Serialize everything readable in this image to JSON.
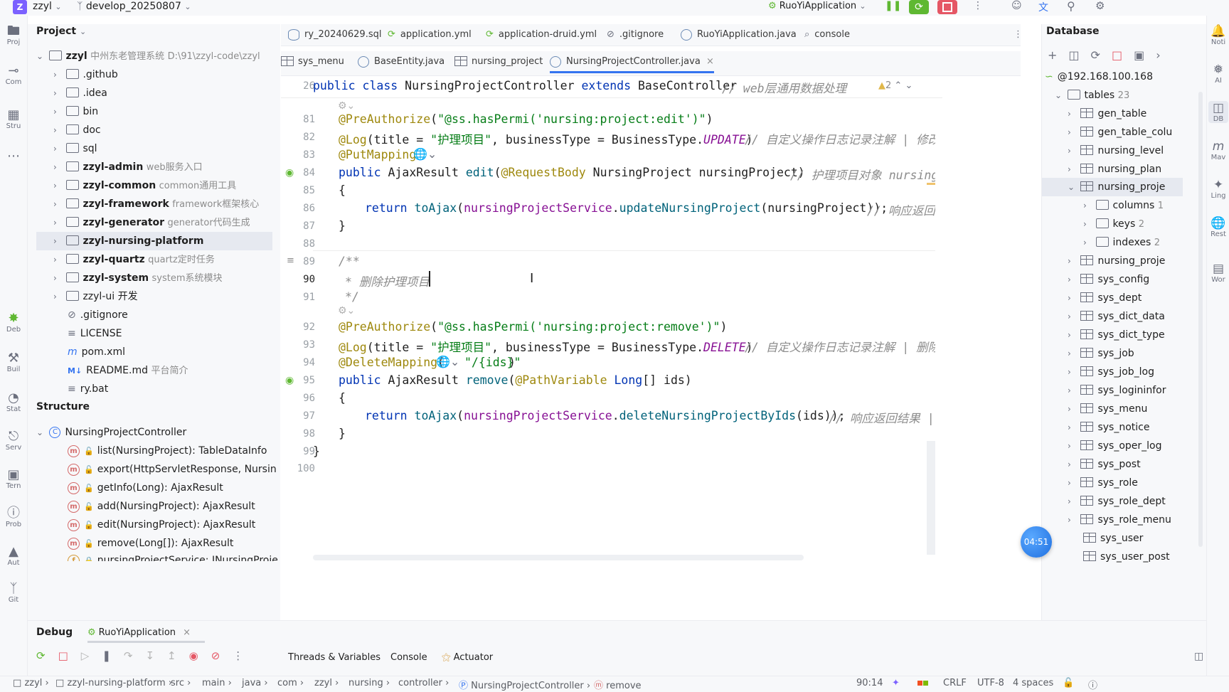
{
  "topbar": {
    "project_badge": "Z",
    "project_name": "zzyl",
    "branch": "develop_20250807",
    "run_config": "RuoYiApplication"
  },
  "left_strip": [
    {
      "icon": "folder-icon",
      "label": "Proj"
    },
    {
      "icon": "commit-icon",
      "label": "Com"
    },
    {
      "icon": "structure-icon",
      "label": "Stru"
    },
    {
      "icon": "more-icon",
      "label": "..."
    },
    {
      "icon": "debug-icon",
      "label": "Deb"
    },
    {
      "icon": "build-icon",
      "label": "Buil"
    },
    {
      "icon": "status-icon",
      "label": "Stat"
    },
    {
      "icon": "services-icon",
      "label": "Serv"
    },
    {
      "icon": "terminal-icon",
      "label": "Tern"
    },
    {
      "icon": "problems-icon",
      "label": "Prob"
    },
    {
      "icon": "warning-icon",
      "label": "Aut"
    },
    {
      "icon": "git-icon",
      "label": "Git"
    }
  ],
  "right_strip": [
    {
      "icon": "notifications-icon",
      "label": "Noti"
    },
    {
      "icon": "ai-icon",
      "label": "AI"
    },
    {
      "icon": "database-icon",
      "label": "DB"
    },
    {
      "icon": "maven-icon",
      "label": "Mav"
    },
    {
      "icon": "lingma-icon",
      "label": "Ling"
    },
    {
      "icon": "rest-icon",
      "label": "Rest"
    },
    {
      "icon": "word-icon",
      "label": "Wor"
    }
  ],
  "project": {
    "title": "Project",
    "root_name": "zzyl",
    "root_desc": "中州东老管理系统",
    "root_path": "D:\\91\\zzyl-code\\zzyl",
    "items": [
      {
        "name": ".github",
        "desc": ""
      },
      {
        "name": ".idea",
        "desc": ""
      },
      {
        "name": "bin",
        "desc": ""
      },
      {
        "name": "doc",
        "desc": ""
      },
      {
        "name": "sql",
        "desc": ""
      },
      {
        "name": "zzyl-admin",
        "desc": "web服务入口"
      },
      {
        "name": "zzyl-common",
        "desc": "common通用工具"
      },
      {
        "name": "zzyl-framework",
        "desc": "framework框架核心"
      },
      {
        "name": "zzyl-generator",
        "desc": "generator代码生成"
      },
      {
        "name": "zzyl-nursing-platform",
        "desc": ""
      },
      {
        "name": "zzyl-quartz",
        "desc": "quartz定时任务"
      },
      {
        "name": "zzyl-system",
        "desc": "system系统模块"
      },
      {
        "name": "zzyl-ui",
        "desc": "开发"
      }
    ],
    "files": [
      {
        "name": ".gitignore",
        "desc": ""
      },
      {
        "name": "LICENSE",
        "desc": ""
      },
      {
        "name": "pom.xml",
        "desc": ""
      },
      {
        "name": "README.md",
        "desc": "平台简介"
      },
      {
        "name": "ry.bat",
        "desc": ""
      }
    ]
  },
  "structure": {
    "title": "Structure",
    "class_name": "NursingProjectController",
    "members": [
      "list(NursingProject): TableDataInfo",
      "export(HttpServletResponse, Nursin",
      "getInfo(Long): AjaxResult",
      "add(NursingProject): AjaxResult",
      "edit(NursingProject): AjaxResult",
      "remove(Long[]): AjaxResult",
      "nursingProjectService: INursingProje"
    ]
  },
  "tabs_row1": [
    "ry_20240629.sql",
    "application.yml",
    "application-druid.yml",
    ".gitignore",
    "RuoYiApplication.java",
    "console"
  ],
  "tabs_row2": [
    "sys_menu",
    "BaseEntity.java",
    "nursing_project",
    "NursingProjectController.java"
  ],
  "editor": {
    "sticky_line": "26",
    "sticky_code": "public class NursingProjectController extends BaseController",
    "sticky_comment": "// web层通用数据处理",
    "warning_count": "2",
    "line_numbers": [
      "81",
      "82",
      "83",
      "84",
      "85",
      "86",
      "87",
      "88",
      "89",
      "90",
      "91",
      "92",
      "93",
      "94",
      "95",
      "96",
      "97",
      "98",
      "99",
      "100"
    ],
    "comments": {
      "log_edit": "// 自定义操作日志记录注解 | 修改",
      "edit_sig": "// 护理项目对象 nursing_",
      "return_edit": "// 响应返回",
      "doc_body": "* 删除护理项目",
      "log_remove": "// 自定义操作日志记录注解 | 删除",
      "return_remove": "// 响应返回结果 |"
    },
    "strings": {
      "perm_edit": "\"@ss.hasPermi('nursing:project:edit')\"",
      "title_edit": "\"护理项目\"",
      "perm_remove": "\"@ss.hasPermi('nursing:project:remove')\"",
      "title_remove": "\"护理项目\"",
      "ids_path": "\"/{ids}\""
    }
  },
  "database": {
    "title": "Database",
    "host": "@192.168.100.168",
    "tables_label": "tables",
    "tables_count": "23",
    "tables": [
      "gen_table",
      "gen_table_colu",
      "nursing_level",
      "nursing_plan",
      "nursing_proje"
    ],
    "subnodes": [
      {
        "name": "columns",
        "count": "1"
      },
      {
        "name": "keys",
        "count": "2"
      },
      {
        "name": "indexes",
        "count": "2"
      }
    ],
    "more_tables": [
      "nursing_proje",
      "sys_config",
      "sys_dept",
      "sys_dict_data",
      "sys_dict_type",
      "sys_job",
      "sys_job_log",
      "sys_logininfor",
      "sys_menu",
      "sys_notice",
      "sys_oper_log",
      "sys_post",
      "sys_role",
      "sys_role_dept",
      "sys_role_menu",
      "sys_user",
      "sys_user_post"
    ],
    "timer_badge": "04:51"
  },
  "debug": {
    "title": "Debug",
    "session": "RuoYiApplication",
    "tabs": [
      "Threads & Variables",
      "Console",
      "Actuator"
    ]
  },
  "status": {
    "crumbs": [
      "zzyl",
      "zzyl-nursing-platform",
      "src",
      "main",
      "java",
      "com",
      "zzyl",
      "nursing",
      "controller",
      "NursingProjectController",
      "remove"
    ],
    "position": "90:14",
    "line_sep": "CRLF",
    "encoding": "UTF-8",
    "indent": "4 spaces"
  },
  "colors": {
    "accent": "#3574f0",
    "run_green": "#5fb832",
    "stop_red": "#e55765"
  }
}
